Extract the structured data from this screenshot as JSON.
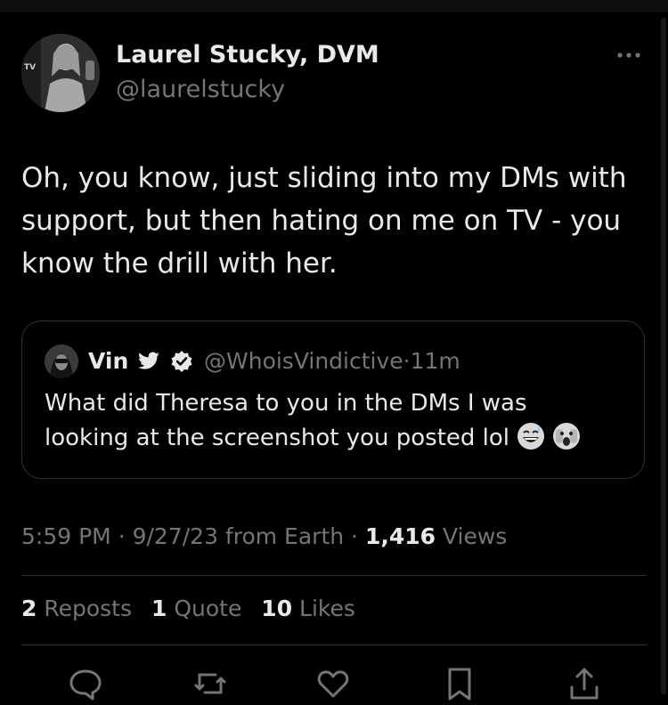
{
  "tweet": {
    "author_name": "Laurel Stucky, DVM",
    "author_handle": "@laurelstucky",
    "text": "Oh, you know, just sliding into my DMs with support, but then hating on me on TV - you know the drill with her.",
    "more_icon": "ellipsis-icon"
  },
  "quote": {
    "name": "Vin",
    "handle": "@WhoisVindictive",
    "separator": "·",
    "time": "11m",
    "text": "What did Theresa to you in the DMs I was looking at the screenshot you posted lol",
    "emoji": [
      "grinning-sweat-emoji",
      "face-peeking-emoji"
    ]
  },
  "meta": {
    "time": "5:59 PM",
    "sep1": "·",
    "date": "9/27/23",
    "source": "from Earth",
    "sep2": "·",
    "views_count": "1,416",
    "views_label": "Views"
  },
  "stats": {
    "reposts_count": "2",
    "reposts_label": "Reposts",
    "quotes_count": "1",
    "quotes_label": "Quote",
    "likes_count": "10",
    "likes_label": "Likes"
  },
  "actions": [
    "reply-icon",
    "repost-icon",
    "like-icon",
    "bookmark-icon",
    "share-icon"
  ],
  "colors": {
    "background": "#000000",
    "text": "#e7e9ea",
    "secondary": "#71767b",
    "border": "#2f3336"
  }
}
